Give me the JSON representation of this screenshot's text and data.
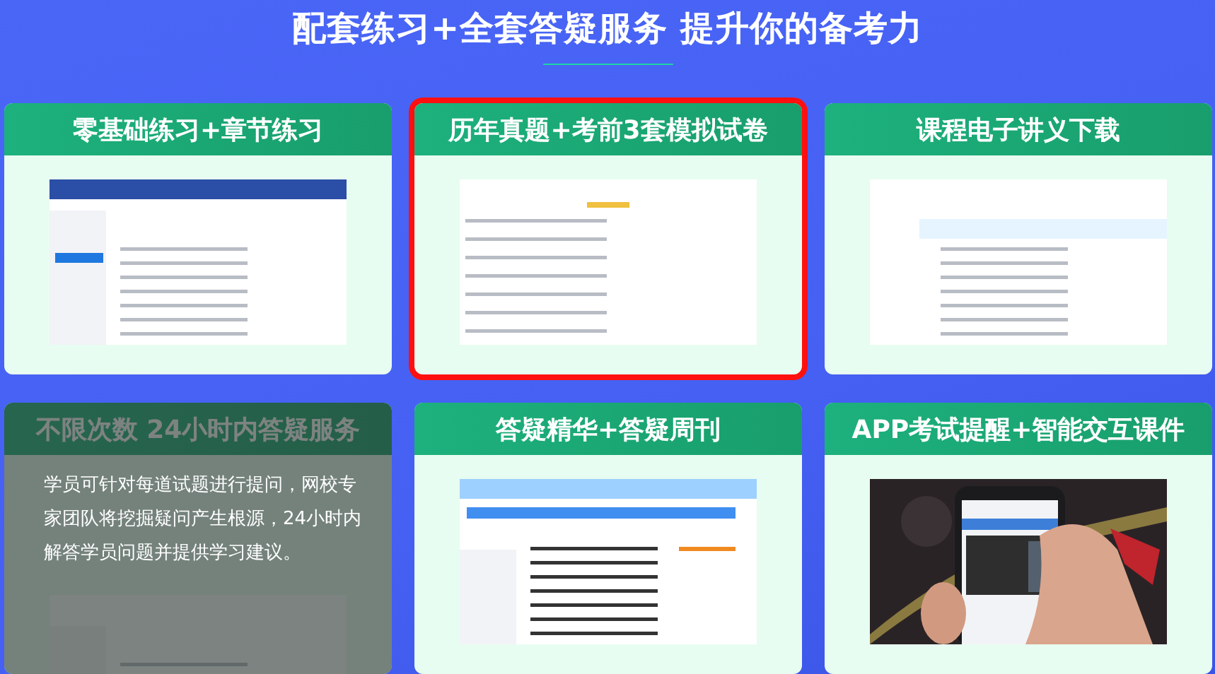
{
  "heading": "配套练习+全套答疑服务 提升你的备考力",
  "cards": [
    {
      "title": "零基础练习+章节练习",
      "selected": false,
      "hovered": false
    },
    {
      "title": "历年真题+考前3套模拟试卷",
      "selected": true,
      "hovered": false
    },
    {
      "title": "课程电子讲义下载",
      "selected": false,
      "hovered": false
    },
    {
      "title": "不限次数 24小时内答疑服务",
      "selected": false,
      "hovered": true,
      "description": "学员可针对每道试题进行提问，网校专家团队将挖掘疑问产生根源，24小时内解答学员问题并提供学习建议。"
    },
    {
      "title": "答疑精华+答疑周刊",
      "selected": false,
      "hovered": false
    },
    {
      "title": "APP考试提醒+智能交互课件",
      "selected": false,
      "hovered": false
    }
  ]
}
